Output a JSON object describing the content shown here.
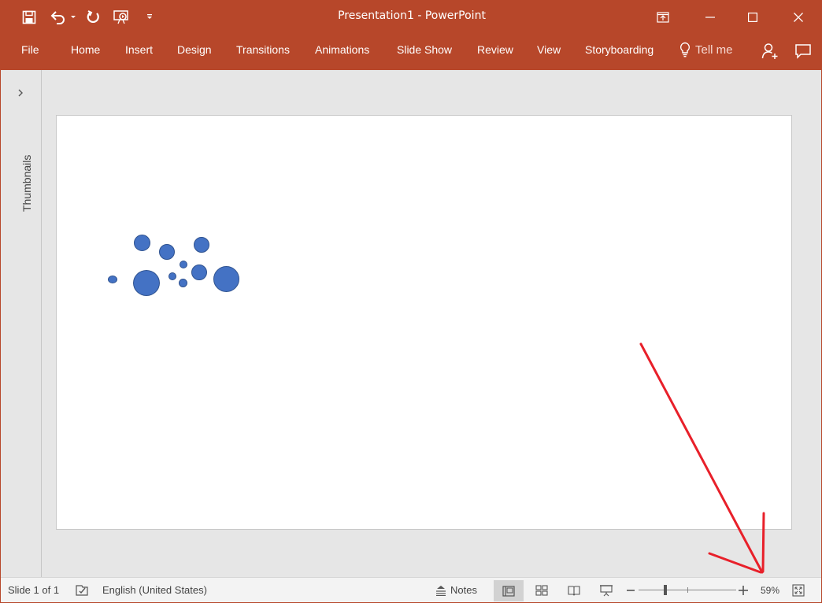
{
  "window": {
    "title": "Presentation1  -  PowerPoint",
    "accent_color": "#b7472a"
  },
  "qat": {
    "icons": [
      "save-icon",
      "undo-icon",
      "redo-icon",
      "present-from-start-icon",
      "customize-qat-icon"
    ]
  },
  "ribbon": {
    "tabs": [
      "File",
      "Home",
      "Insert",
      "Design",
      "Transitions",
      "Animations",
      "Slide Show",
      "Review",
      "View",
      "Storyboarding"
    ],
    "tell_me": "Tell me",
    "icons": [
      "share-user-icon",
      "comments-icon"
    ]
  },
  "window_controls": [
    "ribbon-display-options-icon",
    "minimize-icon",
    "maximize-icon",
    "close-icon"
  ],
  "thumbnails": {
    "label": "Thumbnails"
  },
  "slide": {
    "shapes": "bubbles",
    "shape_color": "#4472c4"
  },
  "statusbar": {
    "slide_info": "Slide 1 of 1",
    "language": "English (United States)",
    "notes": "Notes",
    "zoom": "59%"
  },
  "annotation": {
    "arrow_color": "#e8202a"
  }
}
